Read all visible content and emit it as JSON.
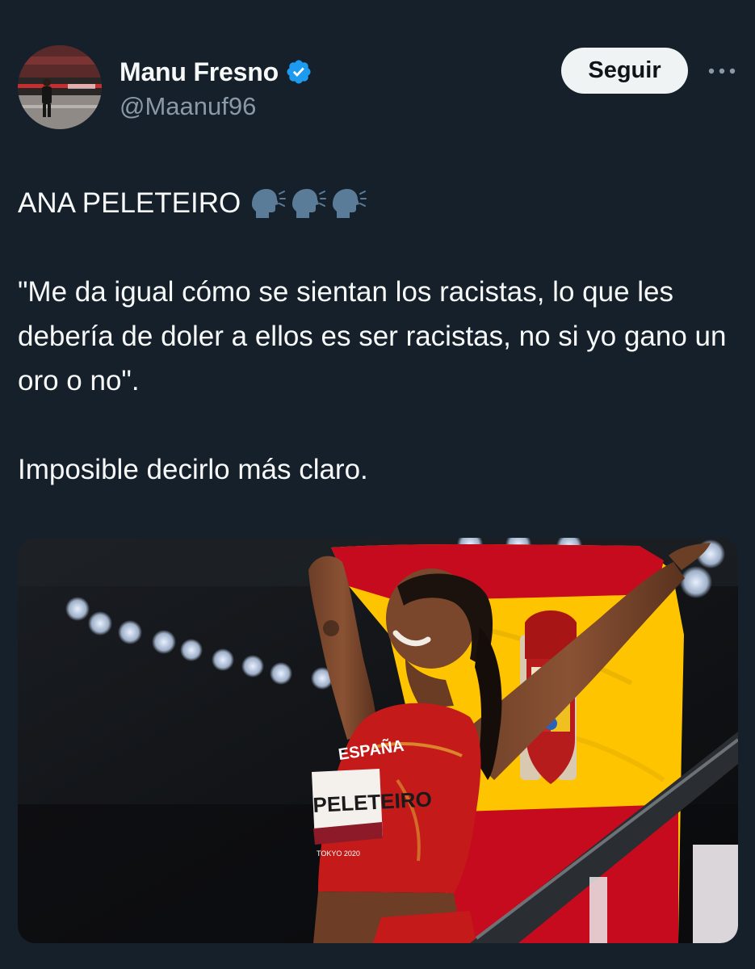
{
  "author": {
    "display_name": "Manu Fresno",
    "handle": "@Maanuf96",
    "verified": true,
    "avatar_icon": "profile-photo"
  },
  "actions": {
    "follow_label": "Seguir",
    "more_icon": "more-dots-icon"
  },
  "post": {
    "line1": "ANA PELETEIRO",
    "line1_emoji": "speaking-head-icon",
    "emoji_count": 3,
    "quote": "\"Me da igual cómo se sientan los racistas, lo que les debería de doler a ellos es ser racistas, no si yo gano un oro o no\".",
    "closing": "Imposible decirlo más claro."
  },
  "media": {
    "bib_text": "PELETEIRO",
    "jersey_text": "ESPAÑA",
    "event_mark": "TOKYO 2020"
  },
  "colors": {
    "background": "#15202b",
    "text_primary": "#f7f9f9",
    "text_secondary": "#8b98a5",
    "verified_blue": "#1d9bf0",
    "follow_bg": "#eff3f4",
    "flag_red": "#c60b1e",
    "flag_yellow": "#ffc400"
  }
}
